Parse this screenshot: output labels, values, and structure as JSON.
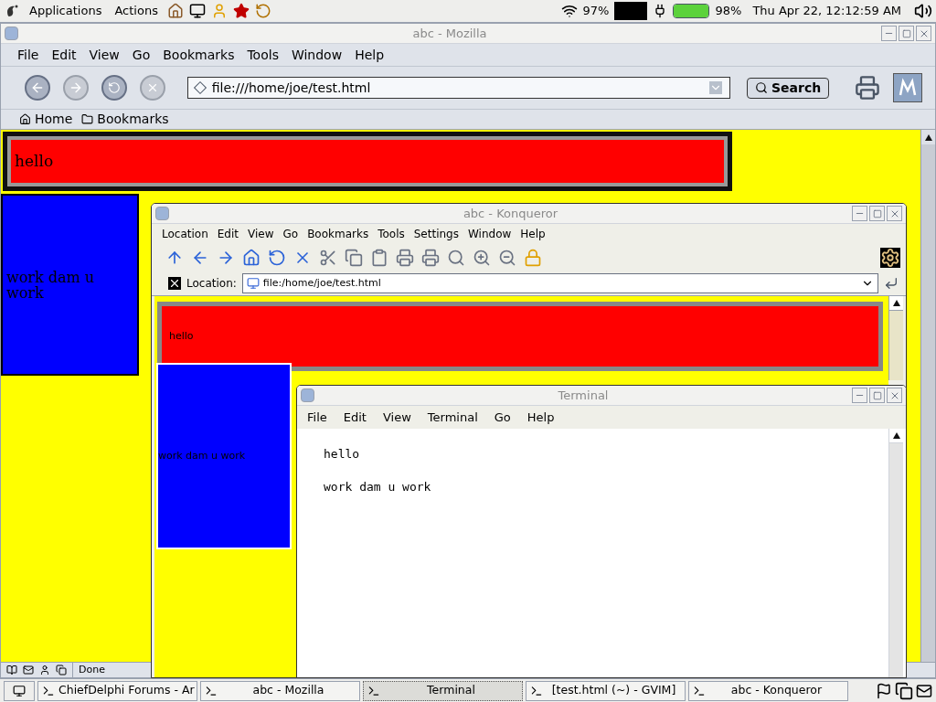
{
  "top_panel": {
    "menus": [
      "Applications",
      "Actions"
    ],
    "wifi_reading": "97%",
    "battery": {
      "level": 0.98,
      "reading": "98%"
    },
    "clock": "Thu Apr 22, 12:12:59 AM"
  },
  "mozilla": {
    "title": "abc - Mozilla",
    "menu": [
      "File",
      "Edit",
      "View",
      "Go",
      "Bookmarks",
      "Tools",
      "Window",
      "Help"
    ],
    "url": "file:///home/joe/test.html",
    "search_button": "Search",
    "personal_toolbar": [
      "Home",
      "Bookmarks"
    ],
    "page": {
      "heading": "hello",
      "box_text": "work dam u work"
    },
    "status": "Done"
  },
  "konqueror": {
    "title": "abc - Konqueror",
    "menu": [
      "Location",
      "Edit",
      "View",
      "Go",
      "Bookmarks",
      "Tools",
      "Settings",
      "Window",
      "Help"
    ],
    "location_label": "Location:",
    "url": "file:/home/joe/test.html",
    "page": {
      "heading": "hello",
      "box_text": "work dam u work"
    }
  },
  "terminal": {
    "title": "Terminal",
    "menu": [
      "File",
      "Edit",
      "View",
      "Terminal",
      "Go",
      "Help"
    ],
    "lines": [
      "hello",
      "work dam u work"
    ]
  },
  "taskbar": {
    "tasks": [
      {
        "label": "ChiefDelphi Forums - Ar",
        "selected": false
      },
      {
        "label": "abc - Mozilla",
        "selected": false
      },
      {
        "label": "Terminal",
        "selected": true
      },
      {
        "label": "[test.html (~) - GVIM]",
        "selected": false
      },
      {
        "label": "abc - Konqueror",
        "selected": false
      }
    ]
  }
}
